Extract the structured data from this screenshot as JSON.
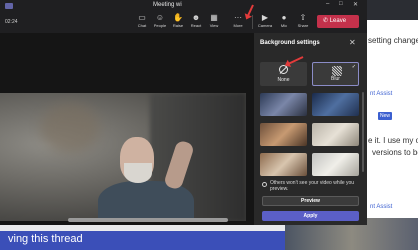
{
  "window": {
    "title": "Meeting wi"
  },
  "toolbar": {
    "time": "02:24",
    "items": [
      {
        "label": "Chat",
        "icon": "chat-icon"
      },
      {
        "label": "People",
        "icon": "people-icon"
      },
      {
        "label": "Raise",
        "icon": "raise-hand-icon"
      },
      {
        "label": "React",
        "icon": "react-icon"
      },
      {
        "label": "View",
        "icon": "view-icon"
      },
      {
        "label": "More",
        "icon": "more-icon"
      },
      {
        "label": "Camera",
        "icon": "camera-icon"
      },
      {
        "label": "Mic",
        "icon": "mic-icon"
      },
      {
        "label": "Share",
        "icon": "share-icon"
      }
    ],
    "leave_label": "Leave"
  },
  "panel": {
    "title": "Background settings",
    "options": [
      {
        "label": "None",
        "icon": "none-icon"
      },
      {
        "label": "Blur",
        "icon": "blur-icon"
      }
    ],
    "checkbox_label": "Others won't see your video while you preview.",
    "preview_label": "Preview",
    "apply_label": "Apply"
  },
  "background_page": {
    "line1": "setting change",
    "line2": "nt Assist",
    "line3": "e it. I use my ov",
    "line4": "versions to be",
    "line5": "nt Assist",
    "new_badge": "New",
    "footer": "ving this thread"
  },
  "colors": {
    "accent": "#5b5fc7",
    "leave": "#c4314b",
    "annotation": "#e23b3b"
  }
}
